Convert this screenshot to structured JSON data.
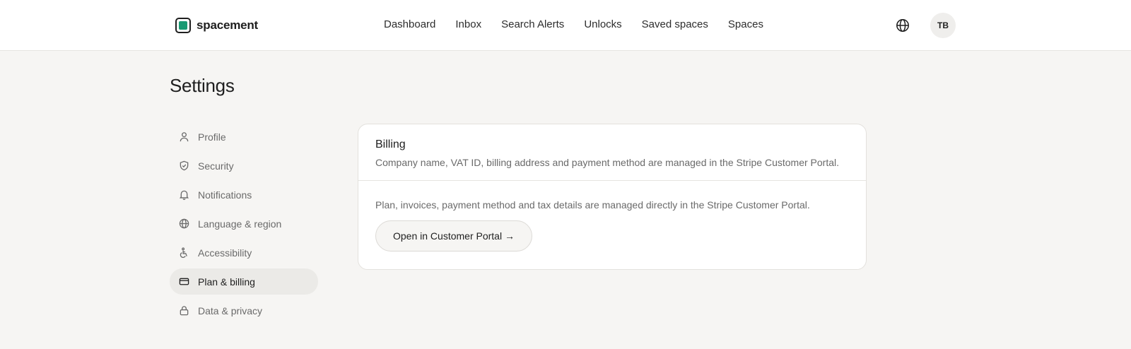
{
  "header": {
    "brand": "spacement",
    "nav": [
      "Dashboard",
      "Inbox",
      "Search Alerts",
      "Unlocks",
      "Saved spaces",
      "Spaces"
    ],
    "avatar_initials": "TB",
    "brand_color": "#1a9a73"
  },
  "page": {
    "title": "Settings"
  },
  "sidebar": {
    "items": [
      {
        "label": "Profile",
        "icon": "user-icon"
      },
      {
        "label": "Security",
        "icon": "shield-icon"
      },
      {
        "label": "Notifications",
        "icon": "bell-icon"
      },
      {
        "label": "Language & region",
        "icon": "globe-icon"
      },
      {
        "label": "Accessibility",
        "icon": "accessibility-icon"
      },
      {
        "label": "Plan & billing",
        "icon": "credit-card-icon",
        "active": true
      },
      {
        "label": "Data & privacy",
        "icon": "lock-icon"
      }
    ]
  },
  "billing": {
    "title": "Billing",
    "description": "Company name, VAT ID, billing address and payment method are managed in the Stripe Customer Portal.",
    "body_text": "Plan, invoices, payment method and tax details are managed directly in the Stripe Customer Portal.",
    "button_label": "Open in Customer Portal →"
  }
}
